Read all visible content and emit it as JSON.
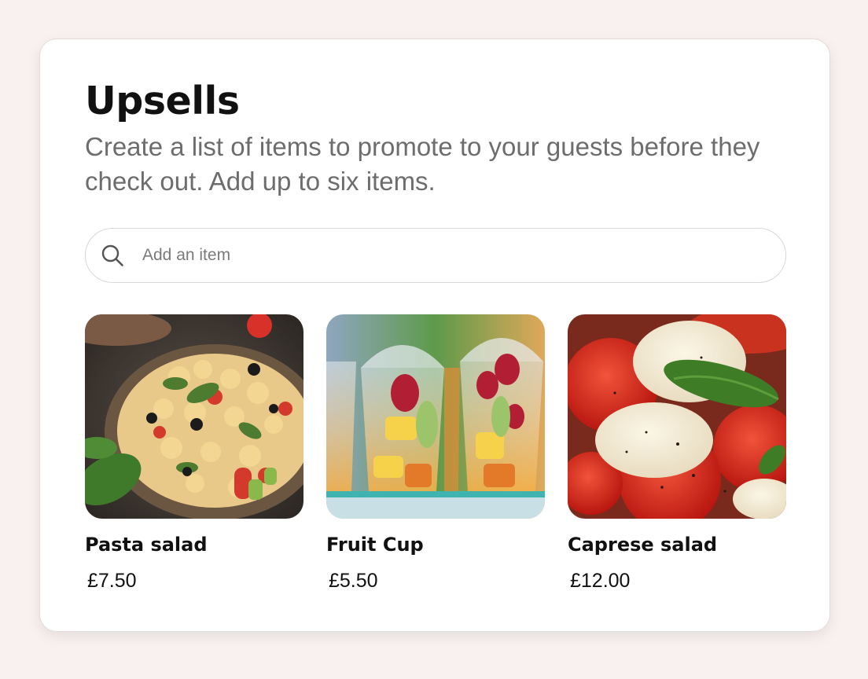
{
  "upsells": {
    "title": "Upsells",
    "description": "Create a list of items to promote to your guests before they check out. Add up to six items.",
    "search": {
      "placeholder": "Add an item",
      "value": "",
      "icon": "search-icon"
    },
    "items": [
      {
        "name": "Pasta salad",
        "price": "£7.50",
        "image": "pasta-salad-photo"
      },
      {
        "name": "Fruit Cup",
        "price": "£5.50",
        "image": "fruit-cup-photo"
      },
      {
        "name": "Caprese salad",
        "price": "£12.00",
        "image": "caprese-salad-photo"
      }
    ]
  }
}
